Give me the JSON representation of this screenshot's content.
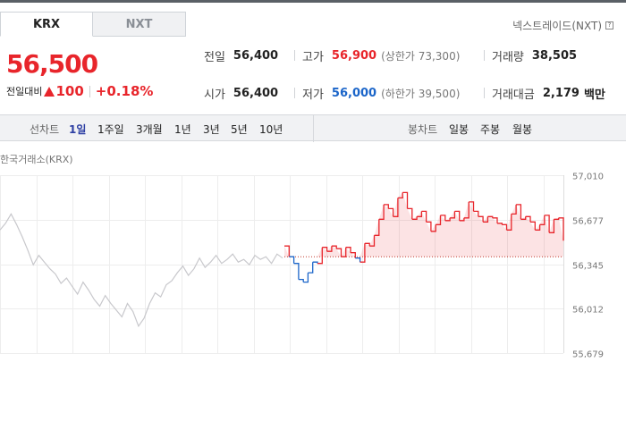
{
  "tabs": {
    "krx": "KRX",
    "nxt": "NXT"
  },
  "nxt_link": "넥스트레이드(NXT)",
  "help_glyph": "?",
  "price": "56,500",
  "change": {
    "label": "전일대비",
    "amount": "100",
    "percent": "+0.18%"
  },
  "stats": {
    "prev_close": {
      "label": "전일",
      "value": "56,400"
    },
    "high": {
      "label": "고가",
      "value": "56,900",
      "sub": "(상한가 73,300)"
    },
    "volume": {
      "label": "거래량",
      "value": "38,505"
    },
    "open": {
      "label": "시가",
      "value": "56,400"
    },
    "low": {
      "label": "저가",
      "value": "56,000",
      "sub": "(하한가 39,500)"
    },
    "amount": {
      "label": "거래대금",
      "value": "2,179",
      "unit": "백만"
    }
  },
  "toolbar": {
    "line_label": "선차트",
    "periods": [
      "1일",
      "1주일",
      "3개월",
      "1년",
      "3년",
      "5년",
      "10년"
    ],
    "active_period": "1일",
    "candle_label": "봉차트",
    "candle_periods": [
      "일봉",
      "주봉",
      "월봉"
    ]
  },
  "chart_title": "한국거래소(KRX)",
  "colors": {
    "up": "#e8252b",
    "down": "#1b65c9",
    "prev": "#c8c8cc",
    "accent": "#2d3fa3"
  },
  "chart_data": {
    "type": "line",
    "title": "",
    "ylabel": "",
    "y_ticks": [
      "57,010",
      "56,677",
      "56,345",
      "56,012",
      "55,679"
    ],
    "ylim": [
      55679,
      57010
    ],
    "baseline": 56400,
    "previous_day": [
      56600,
      56650,
      56720,
      56640,
      56550,
      56450,
      56340,
      56410,
      56360,
      56310,
      56270,
      56200,
      56240,
      56180,
      56120,
      56210,
      56150,
      56080,
      56030,
      56110,
      56050,
      56000,
      55950,
      56050,
      55990,
      55880,
      55940,
      56050,
      56130,
      56100,
      56190,
      56220,
      56280,
      56330,
      56260,
      56310,
      56390,
      56320,
      56360,
      56410,
      56350,
      56380,
      56420,
      56360,
      56380,
      56340,
      56410,
      56380,
      56400,
      56350,
      56420,
      56390
    ],
    "today": [
      56480,
      56400,
      56350,
      56230,
      56210,
      56280,
      56360,
      56350,
      56470,
      56440,
      56480,
      56460,
      56400,
      56470,
      56430,
      56390,
      56360,
      56500,
      56480,
      56560,
      56680,
      56790,
      56760,
      56700,
      56840,
      56880,
      56760,
      56680,
      56700,
      56740,
      56660,
      56590,
      56640,
      56710,
      56670,
      56690,
      56740,
      56670,
      56690,
      56810,
      56740,
      56700,
      56660,
      56700,
      56690,
      56650,
      56640,
      56600,
      56720,
      56790,
      56680,
      56700,
      56660,
      56600,
      56640,
      56710,
      56580,
      56680,
      56690,
      56520
    ]
  }
}
